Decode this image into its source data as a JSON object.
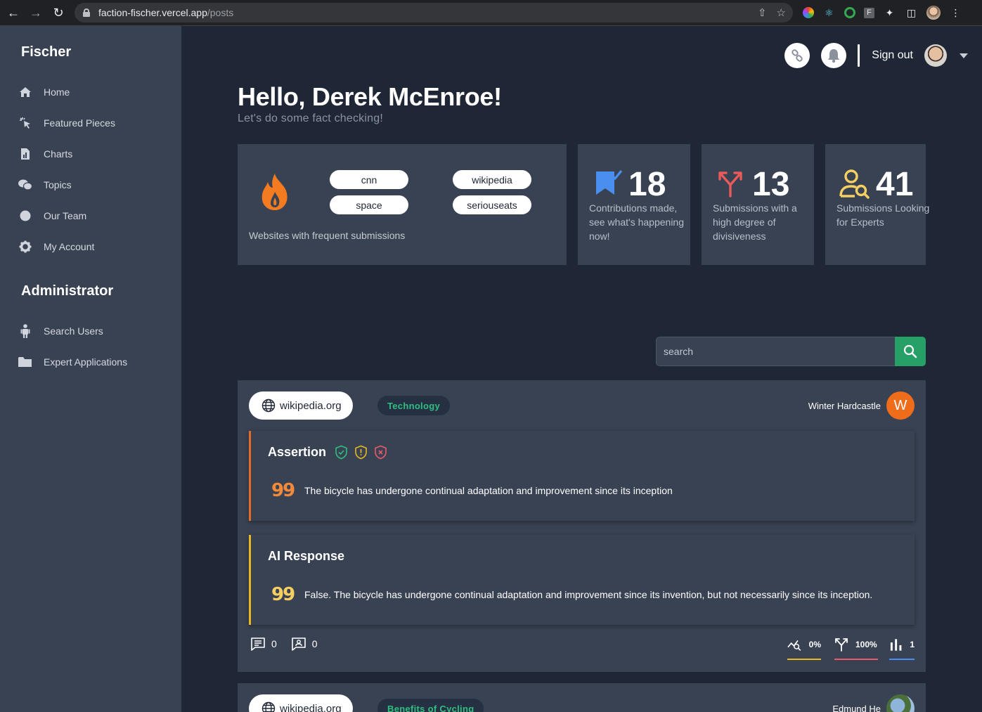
{
  "browser": {
    "url_host": "faction-fischer.vercel.app",
    "url_path": "/posts"
  },
  "sidebar": {
    "brand": "Fischer",
    "items": [
      {
        "label": "Home",
        "icon": "home-icon"
      },
      {
        "label": "Featured Pieces",
        "icon": "cursor-click-icon"
      },
      {
        "label": "Charts",
        "icon": "chart-file-icon"
      },
      {
        "label": "Topics",
        "icon": "chat-bubbles-icon"
      },
      {
        "label": "Our Team",
        "icon": "circle-icon"
      },
      {
        "label": "My Account",
        "icon": "gear-icon"
      }
    ],
    "admin_title": "Administrator",
    "admin_items": [
      {
        "label": "Search Users",
        "icon": "person-icon"
      },
      {
        "label": "Expert Applications",
        "icon": "folder-icon"
      }
    ]
  },
  "topbar": {
    "sign_out": "Sign out"
  },
  "greeting": {
    "title": "Hello, Derek McEnroe!",
    "subtitle": "Let's do some fact checking!"
  },
  "stats": {
    "sites": [
      "cnn",
      "wikipedia",
      "space",
      "seriouseats"
    ],
    "sites_caption": "Websites with frequent submissions",
    "contributions": {
      "value": "18",
      "text": "Contributions made, see what's happening now!"
    },
    "divisive": {
      "value": "13",
      "text": "Submissions with a high degree of divisiveness"
    },
    "experts": {
      "value": "41",
      "text": "Submissions Looking for Experts"
    }
  },
  "search": {
    "placeholder": "search"
  },
  "posts": [
    {
      "site": "wikipedia.org",
      "topic": "Technology",
      "author": "Winter Hardcastle",
      "author_initial": "W",
      "assertion_title": "Assertion",
      "assertion_quote": "99",
      "assertion_text": "The bicycle has undergone continual adaptation and improvement since its inception",
      "ai_title": "AI Response",
      "ai_quote": "99",
      "ai_text": "False. The bicycle has undergone continual adaptation and improvement since its invention, but not necessarily since its inception.",
      "comments": "0",
      "expert_replies": "0",
      "agreement": "0%",
      "divisiveness": "100%",
      "votes": "1"
    },
    {
      "site": "wikipedia.org",
      "topic": "Benefits of Cycling",
      "author": "Edmund He"
    }
  ],
  "colors": {
    "accent_green": "#27a067",
    "flame": "#f47b20",
    "bookmark": "#4a8ef0",
    "divisive": "#e95a5a",
    "expert": "#f5d061"
  }
}
